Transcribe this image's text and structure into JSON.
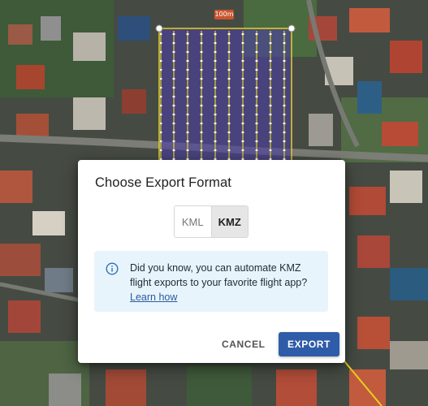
{
  "map": {
    "scale_label": "100m"
  },
  "dialog": {
    "title": "Choose Export Format",
    "format_toggle": {
      "options": [
        "KML",
        "KMZ"
      ],
      "selected": "KMZ"
    },
    "info": {
      "icon": "info-icon",
      "message": "Did you know, you can automate KMZ flight exports to your favorite flight app?",
      "link_label": "Learn how"
    },
    "actions": {
      "cancel_label": "CANCEL",
      "export_label": "EXPORT"
    }
  },
  "colors": {
    "primary": "#2f5ca8",
    "info_background": "#e8f4fb",
    "flight_area": "#4a3fa0",
    "flight_path": "#e6d21a"
  }
}
